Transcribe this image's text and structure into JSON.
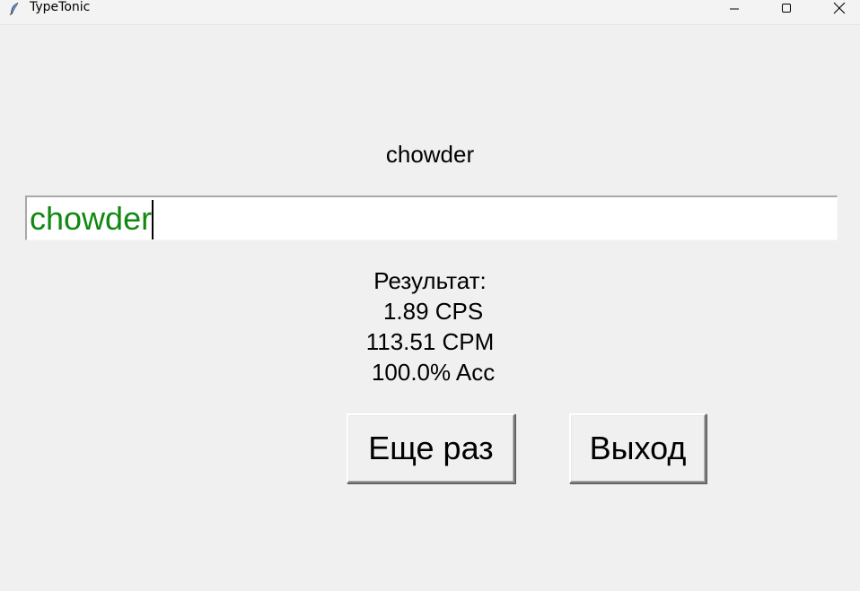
{
  "window": {
    "title": "TypeTonic",
    "icon": "feather-icon"
  },
  "target_word": "chowder",
  "input": {
    "value": "chowder",
    "text_color": "#118811"
  },
  "results": {
    "heading": "Результат:",
    "cps": " 1.89 CPS",
    "cpm": "113.51 CPM",
    "accuracy": " 100.0% Acc"
  },
  "buttons": {
    "again_label": "Еще раз",
    "exit_label": "Выход"
  }
}
